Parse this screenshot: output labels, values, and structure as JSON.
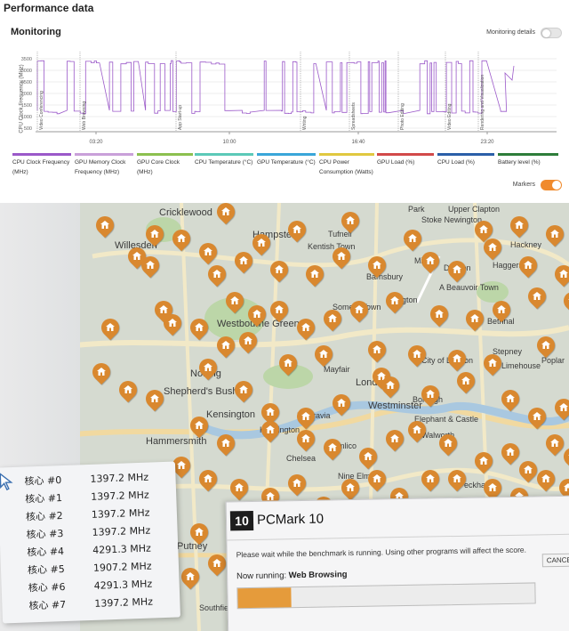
{
  "perf": {
    "title": "Performance data",
    "monitoring_title": "Monitoring",
    "monitoring_details_label": "Monitoring details",
    "markers_label": "Markers",
    "y_axis_label": "CPU Clock Frequency (MHz)",
    "y_ticks": [
      "3500",
      "3000",
      "2500",
      "2000",
      "1500",
      "1000",
      "500"
    ],
    "x_ticks": [
      "03:20",
      "10:00",
      "16:40",
      "23:20"
    ],
    "markers": [
      "Video Conferencing",
      "Web Browsing",
      "App Start-up",
      "Writing",
      "Spreadsheets",
      "Photo Editing",
      "Video Editing",
      "Rendering and Visualization"
    ],
    "legend": [
      {
        "label": "CPU Clock Frequency (MHz)",
        "color": "#9b59c9"
      },
      {
        "label": "GPU Memory Clock Frequency (MHz)",
        "color": "#c9a0d9"
      },
      {
        "label": "GPU Core Clock (MHz)",
        "color": "#8cc04f"
      },
      {
        "label": "CPU Temperature (°C)",
        "color": "#5cc9b8"
      },
      {
        "label": "GPU Temperature (°C)",
        "color": "#3aa6d9"
      },
      {
        "label": "CPU Power Consumption (Watts)",
        "color": "#e0c840"
      },
      {
        "label": "GPU Load (%)",
        "color": "#d24a4a"
      },
      {
        "label": "CPU Load (%)",
        "color": "#2b5fa8"
      },
      {
        "label": "Battery level (%)",
        "color": "#2e7d3a"
      }
    ]
  },
  "map": {
    "labels": [
      "Cricklewood",
      "Hampstead",
      "Tufnell",
      "Upper Clapton",
      "Stoke Newington",
      "Willesden",
      "Kentish Town",
      "Park",
      "Mildm",
      "Dalston",
      "Haggerston",
      "Hackney",
      "Somers Town",
      "Islington",
      "Barnsbury",
      "A Beauvoir Town",
      "Westbourne Green",
      "Bethnal",
      "Notting",
      "City of London",
      "Stepney",
      "Limehouse",
      "Poplar",
      "Shepherd's Bush",
      "Mayfair",
      "London",
      "Borough",
      "Kensington",
      "Belgravia",
      "Westminster",
      "Elephant & Castle",
      "Hammersmith",
      "Walworth",
      "Kensington",
      "Chelsea",
      "Pimlico",
      "Nine Elms",
      "Peckham",
      "Putney",
      "Southfields"
    ]
  },
  "cores": [
    {
      "name": "核心 #0",
      "freq": "1397.2 MHz"
    },
    {
      "name": "核心 #1",
      "freq": "1397.2 MHz"
    },
    {
      "name": "核心 #2",
      "freq": "1397.2 MHz"
    },
    {
      "name": "核心 #3",
      "freq": "1397.2 MHz"
    },
    {
      "name": "核心 #4",
      "freq": "4291.3 MHz"
    },
    {
      "name": "核心 #5",
      "freq": "1907.2 MHz"
    },
    {
      "name": "核心 #6",
      "freq": "4291.3 MHz"
    },
    {
      "name": "核心 #7",
      "freq": "1397.2 MHz"
    }
  ],
  "pcmark": {
    "logo": "10",
    "title": "PCMark 10",
    "message": "Please wait while the benchmark is running. Using other programs will affect the score.",
    "now_running_label": "Now running:",
    "now_running_value": "Web Browsing",
    "cancel_label": "CANCEL",
    "progress": 0.18
  }
}
